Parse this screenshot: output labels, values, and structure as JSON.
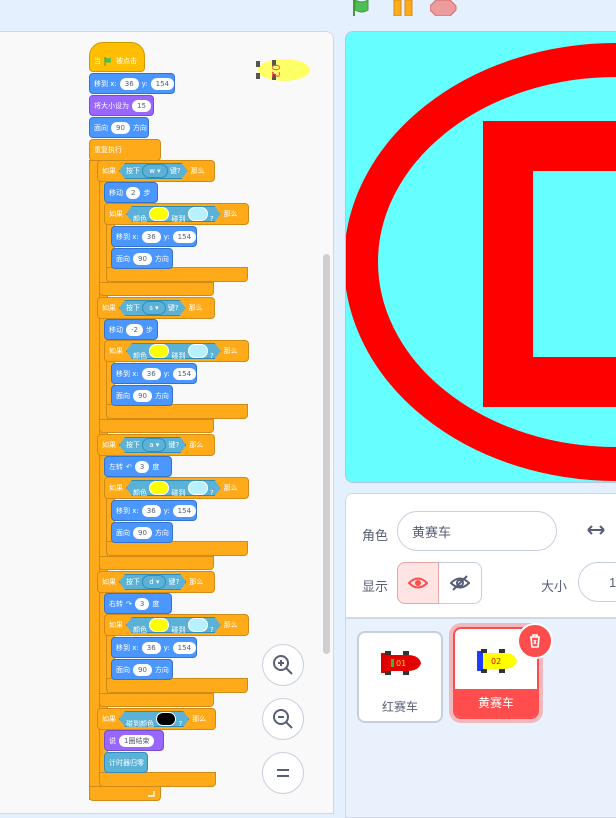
{
  "code": {
    "when_clicked_prefix": "当",
    "when_clicked_suffix": "被点击",
    "goto_label": "移到 x:",
    "y_label": "y:",
    "goto_x": "36",
    "goto_y": "154",
    "set_size_label": "将大小设为",
    "size_value": "15",
    "point_label": "面向",
    "point_value": "90",
    "direction_word": "方向",
    "forever_label": "重复执行",
    "if_label": "如果",
    "then_label": "那么",
    "key_pressed_label": "按下",
    "key_suffix": "键?",
    "key_w": "w ▾",
    "key_s": "s ▾",
    "key_a": "a ▾",
    "key_d": "d ▾",
    "move_label": "移动",
    "steps_label": "步",
    "move_forward": "2",
    "move_back": "-2",
    "color_label": "颜色",
    "touch_label": "碰到",
    "question": "?",
    "turn_left_label": "左转",
    "turn_right_label": "右转",
    "turn_value": "3",
    "degrees_label": "度",
    "touching_color_label": "碰到颜色",
    "say_label": "说",
    "say_value": "1圈结束",
    "reset_timer_label": "计时器归零",
    "colors": {
      "yellow": "#ffff00",
      "cyan": "#b8f0ff",
      "black": "#000000"
    }
  },
  "zoom": {
    "in_icon": "zoom-in-icon",
    "out_icon": "zoom-out-icon",
    "reset_icon": "zoom-reset-icon"
  },
  "sprite_info": {
    "sprite_label": "角色",
    "sprite_name": "黄赛车",
    "show_label": "显示",
    "size_label": "大小",
    "size_value": "1"
  },
  "sprites": [
    {
      "name": "红赛车",
      "selected": false
    },
    {
      "name": "黄赛车",
      "selected": true
    }
  ],
  "stage_colors": {
    "background": "#66ffff",
    "track": "#ff0000"
  }
}
